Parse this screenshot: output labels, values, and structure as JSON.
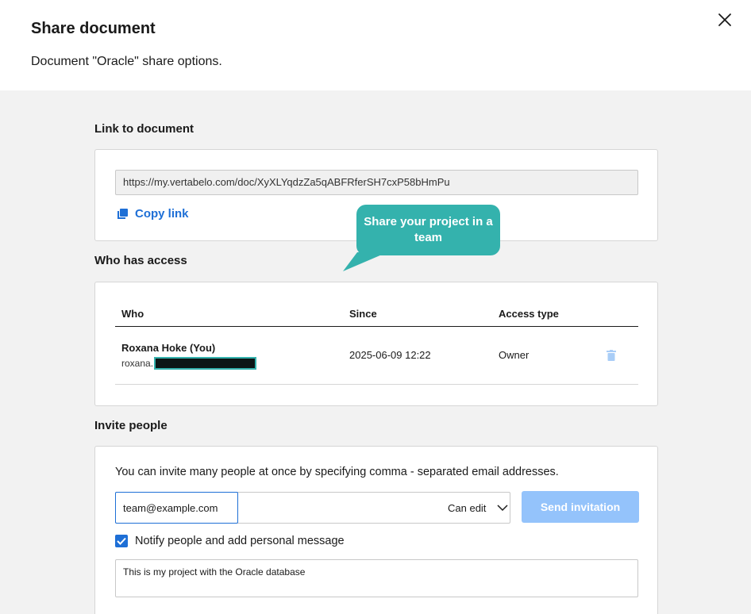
{
  "dialog": {
    "title": "Share document",
    "subtitle": "Document \"Oracle\" share options."
  },
  "link_section": {
    "label": "Link to document",
    "url": "https://my.vertabelo.com/doc/XyXLYqdzZa5qABFRferSH7cxP58bHmPu",
    "copy_label": "Copy link"
  },
  "access_section": {
    "label": "Who has access",
    "columns": {
      "who": "Who",
      "since": "Since",
      "access": "Access type"
    },
    "rows": [
      {
        "name": "Roxana Hoke (You)",
        "email_prefix": "roxana.",
        "since": "2025-06-09 12:22",
        "access": "Owner"
      }
    ]
  },
  "invite_section": {
    "label": "Invite people",
    "help_text": "You can invite many people at once by specifying comma - separated email addresses.",
    "email_value": "team@example.com",
    "permission": "Can edit",
    "send_label": "Send invitation",
    "notify_label": "Notify people and add personal message",
    "notify_checked": true,
    "message": "This is my project with the Oracle database"
  },
  "tooltip": {
    "text": "Share your project in a team"
  },
  "colors": {
    "accent": "#1e6fd6",
    "tooltip": "#34b2ad",
    "button_disabled": "#94c3fb"
  }
}
